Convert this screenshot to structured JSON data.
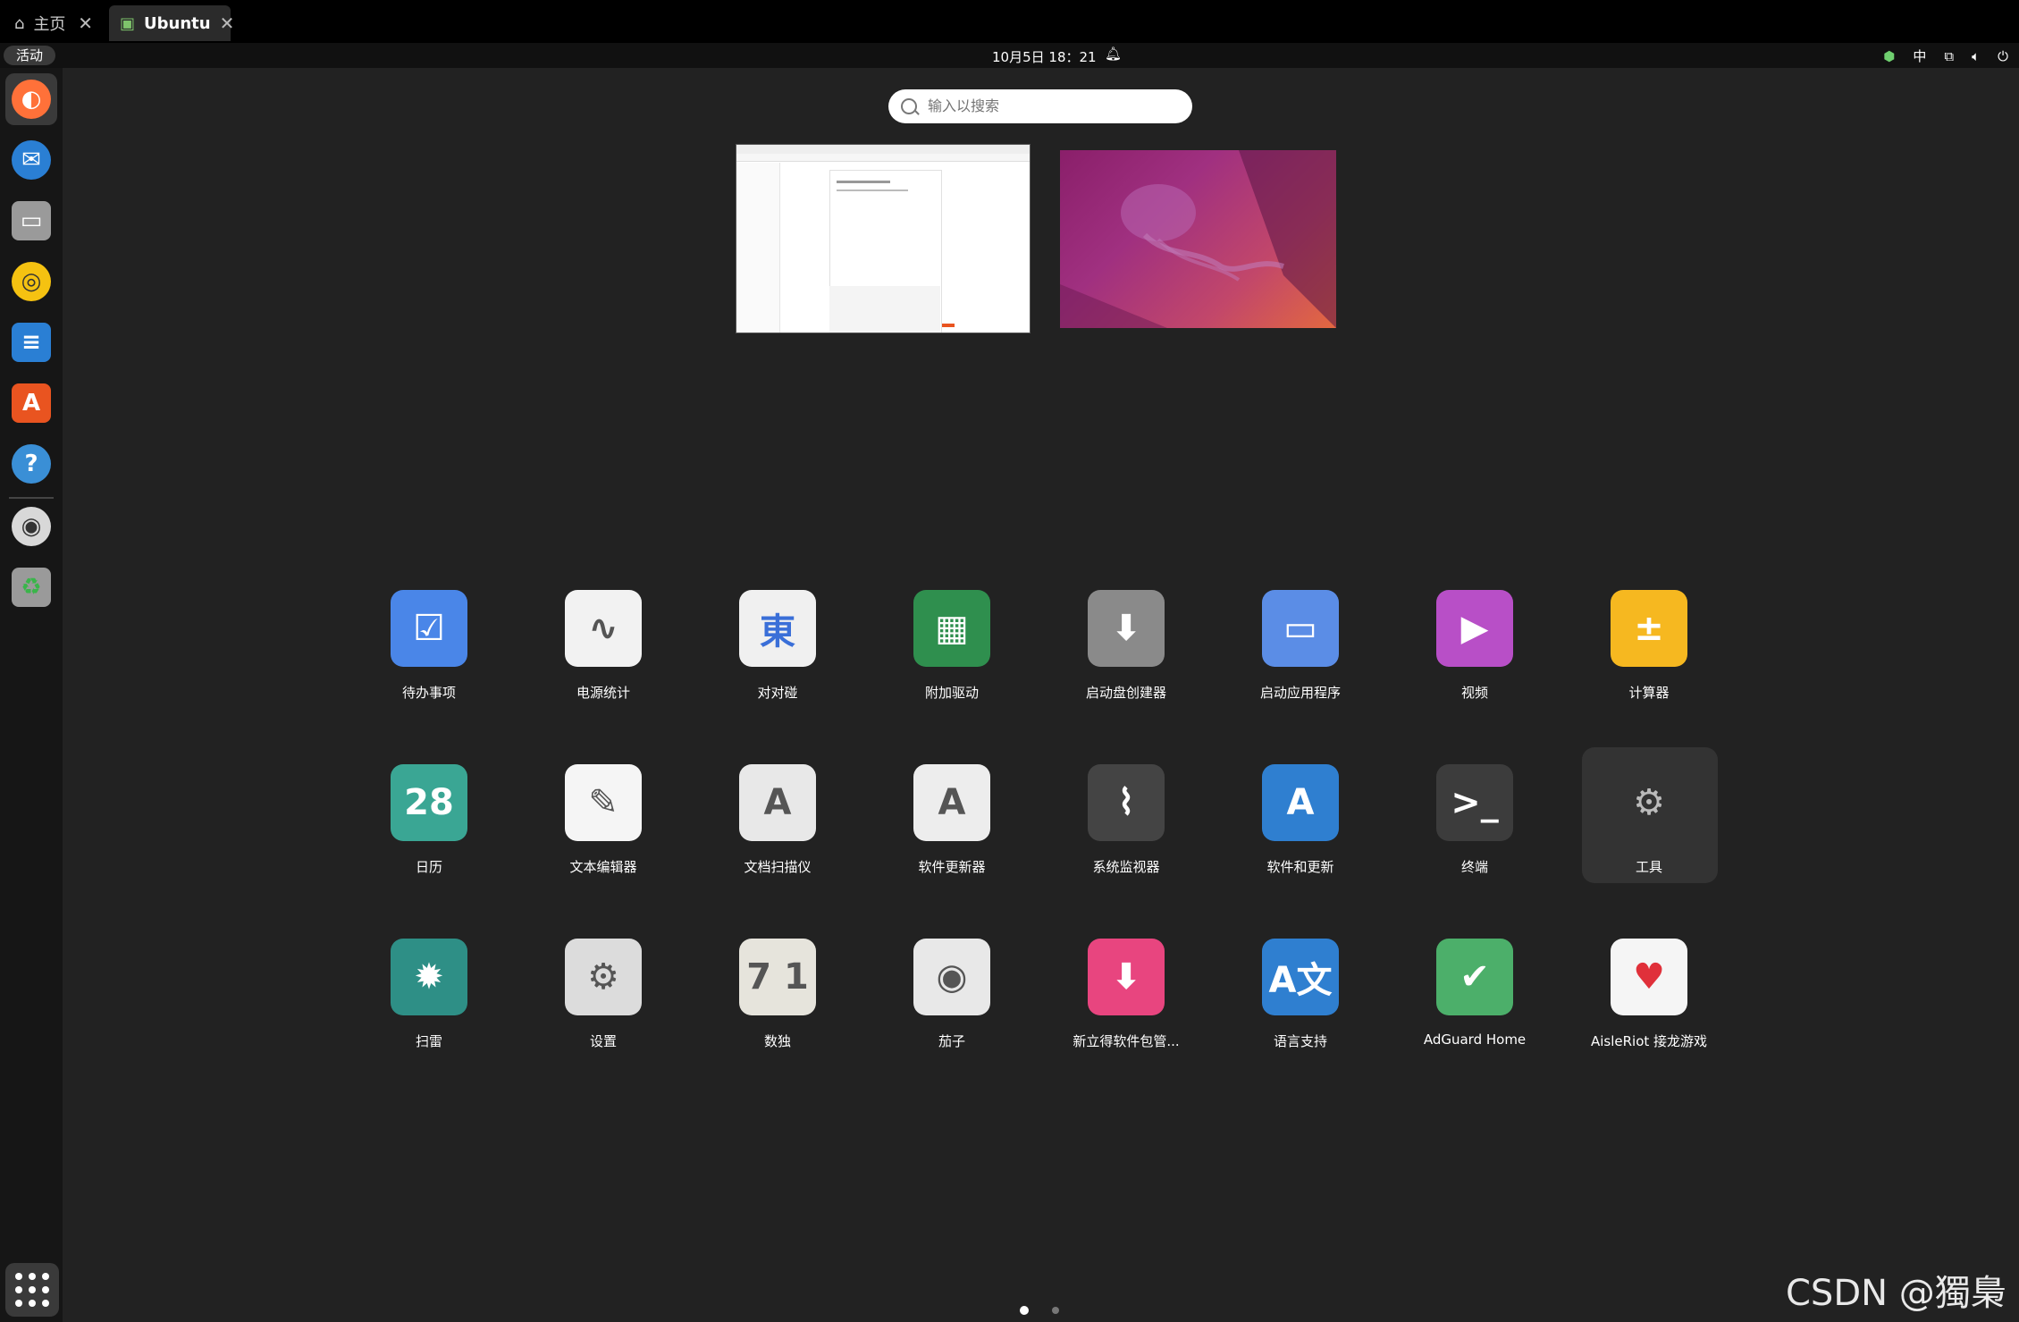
{
  "browser": {
    "tabs": [
      {
        "label": "主页",
        "icon": "home-icon"
      },
      {
        "label": "Ubuntu",
        "icon": "vm-icon"
      }
    ]
  },
  "panel": {
    "activities": "活动",
    "clock": "10月5日  18：21",
    "input_method": "中"
  },
  "search": {
    "placeholder": "输入以搜索"
  },
  "apps": [
    {
      "label": "待办事项",
      "icon": "todo-icon",
      "color": "#4a86e8"
    },
    {
      "label": "电源统计",
      "icon": "power-statistics-icon",
      "color": "#f2f2f2"
    },
    {
      "label": "对对碰",
      "icon": "mahjongg-icon",
      "color": "#f0f0f0"
    },
    {
      "label": "附加驱动",
      "icon": "additional-drivers-icon",
      "color": "#2f8f4e"
    },
    {
      "label": "启动盘创建器",
      "icon": "startup-disk-creator-icon",
      "color": "#8a8a8a"
    },
    {
      "label": "启动应用程序",
      "icon": "startup-applications-icon",
      "color": "#5b8de6"
    },
    {
      "label": "视频",
      "icon": "videos-icon",
      "color": "#b84fc7"
    },
    {
      "label": "计算器",
      "icon": "calculator-icon",
      "color": "#f6b820"
    },
    {
      "label": "日历",
      "icon": "calendar-icon",
      "color": "#3aa694",
      "text": "28"
    },
    {
      "label": "文本编辑器",
      "icon": "text-editor-icon",
      "color": "#f5f5f5"
    },
    {
      "label": "文档扫描仪",
      "icon": "document-scanner-icon",
      "color": "#e8e8e8"
    },
    {
      "label": "软件更新器",
      "icon": "software-updater-icon",
      "color": "#ededed"
    },
    {
      "label": "系统监视器",
      "icon": "system-monitor-icon",
      "color": "#444444"
    },
    {
      "label": "软件和更新",
      "icon": "software-properties-icon",
      "color": "#2f7fd0"
    },
    {
      "label": "终端",
      "icon": "terminal-icon",
      "color": "#3c3c3c",
      "text": ">_"
    },
    {
      "label": "工具",
      "icon": "utilities-folder-icon",
      "color": "#333333"
    },
    {
      "label": "扫雷",
      "icon": "mines-icon",
      "color": "#2e8f86"
    },
    {
      "label": "设置",
      "icon": "settings-icon",
      "color": "#dcdcdc"
    },
    {
      "label": "数独",
      "icon": "sudoku-icon",
      "color": "#e6e4dc"
    },
    {
      "label": "茄子",
      "icon": "cheese-icon",
      "color": "#e8e8e8"
    },
    {
      "label": "新立得软件包管...",
      "icon": "synaptic-icon",
      "color": "#e8457f"
    },
    {
      "label": "语言支持",
      "icon": "language-support-icon",
      "color": "#2f7fd0"
    },
    {
      "label": "AdGuard Home",
      "icon": "adguard-icon",
      "color": "#4caf6a"
    },
    {
      "label": "AisleRiot 接龙游戏",
      "icon": "aisleriot-icon",
      "color": "#f5f5f5"
    }
  ],
  "dock": [
    {
      "name": "firefox-icon",
      "color": "#ff7139"
    },
    {
      "name": "thunderbird-icon",
      "color": "#2a7fd4"
    },
    {
      "name": "files-icon",
      "color": "#9a9a9a"
    },
    {
      "name": "rhythmbox-icon",
      "color": "#f5c211"
    },
    {
      "name": "writer-icon",
      "color": "#2a7fd4"
    },
    {
      "name": "app-center-icon",
      "color": "#e95420"
    },
    {
      "name": "help-icon",
      "color": "#3a8fd6"
    },
    {
      "name": "disc-icon",
      "color": "#d8d8d8"
    },
    {
      "name": "trash-icon",
      "color": "#9a9a9a"
    }
  ],
  "watermark": "CSDN @獨梟"
}
